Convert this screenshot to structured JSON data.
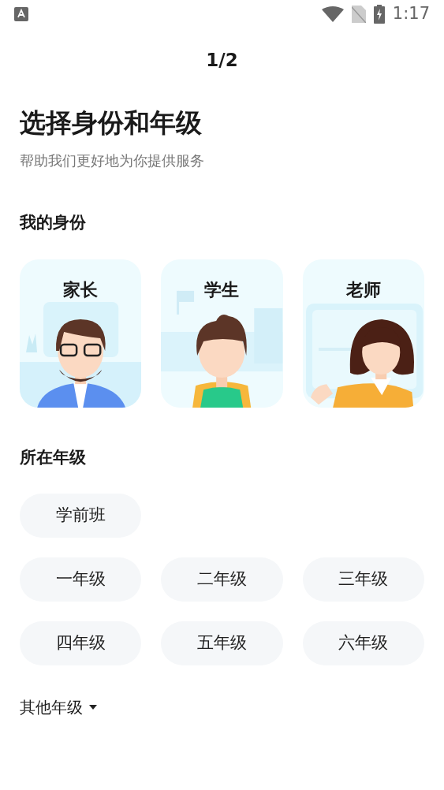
{
  "status_bar": {
    "time": "1:17"
  },
  "header": {
    "step": "1/2"
  },
  "title": "选择身份和年级",
  "subtitle": "帮助我们更好地为你提供服务",
  "identity": {
    "heading": "我的身份",
    "cards": [
      {
        "label": "家长",
        "kind": "parent",
        "selected": false
      },
      {
        "label": "学生",
        "kind": "student",
        "selected": false
      },
      {
        "label": "老师",
        "kind": "teacher",
        "selected": false
      }
    ]
  },
  "grade": {
    "heading": "所在年级",
    "rows": [
      [
        {
          "label": "学前班",
          "selected": false
        }
      ],
      [
        {
          "label": "一年级",
          "selected": false
        },
        {
          "label": "二年级",
          "selected": false
        },
        {
          "label": "三年级",
          "selected": false
        }
      ],
      [
        {
          "label": "四年级",
          "selected": false
        },
        {
          "label": "五年级",
          "selected": false
        },
        {
          "label": "六年级",
          "selected": false
        }
      ]
    ],
    "other": {
      "label": "其他年级",
      "expanded": false
    }
  }
}
